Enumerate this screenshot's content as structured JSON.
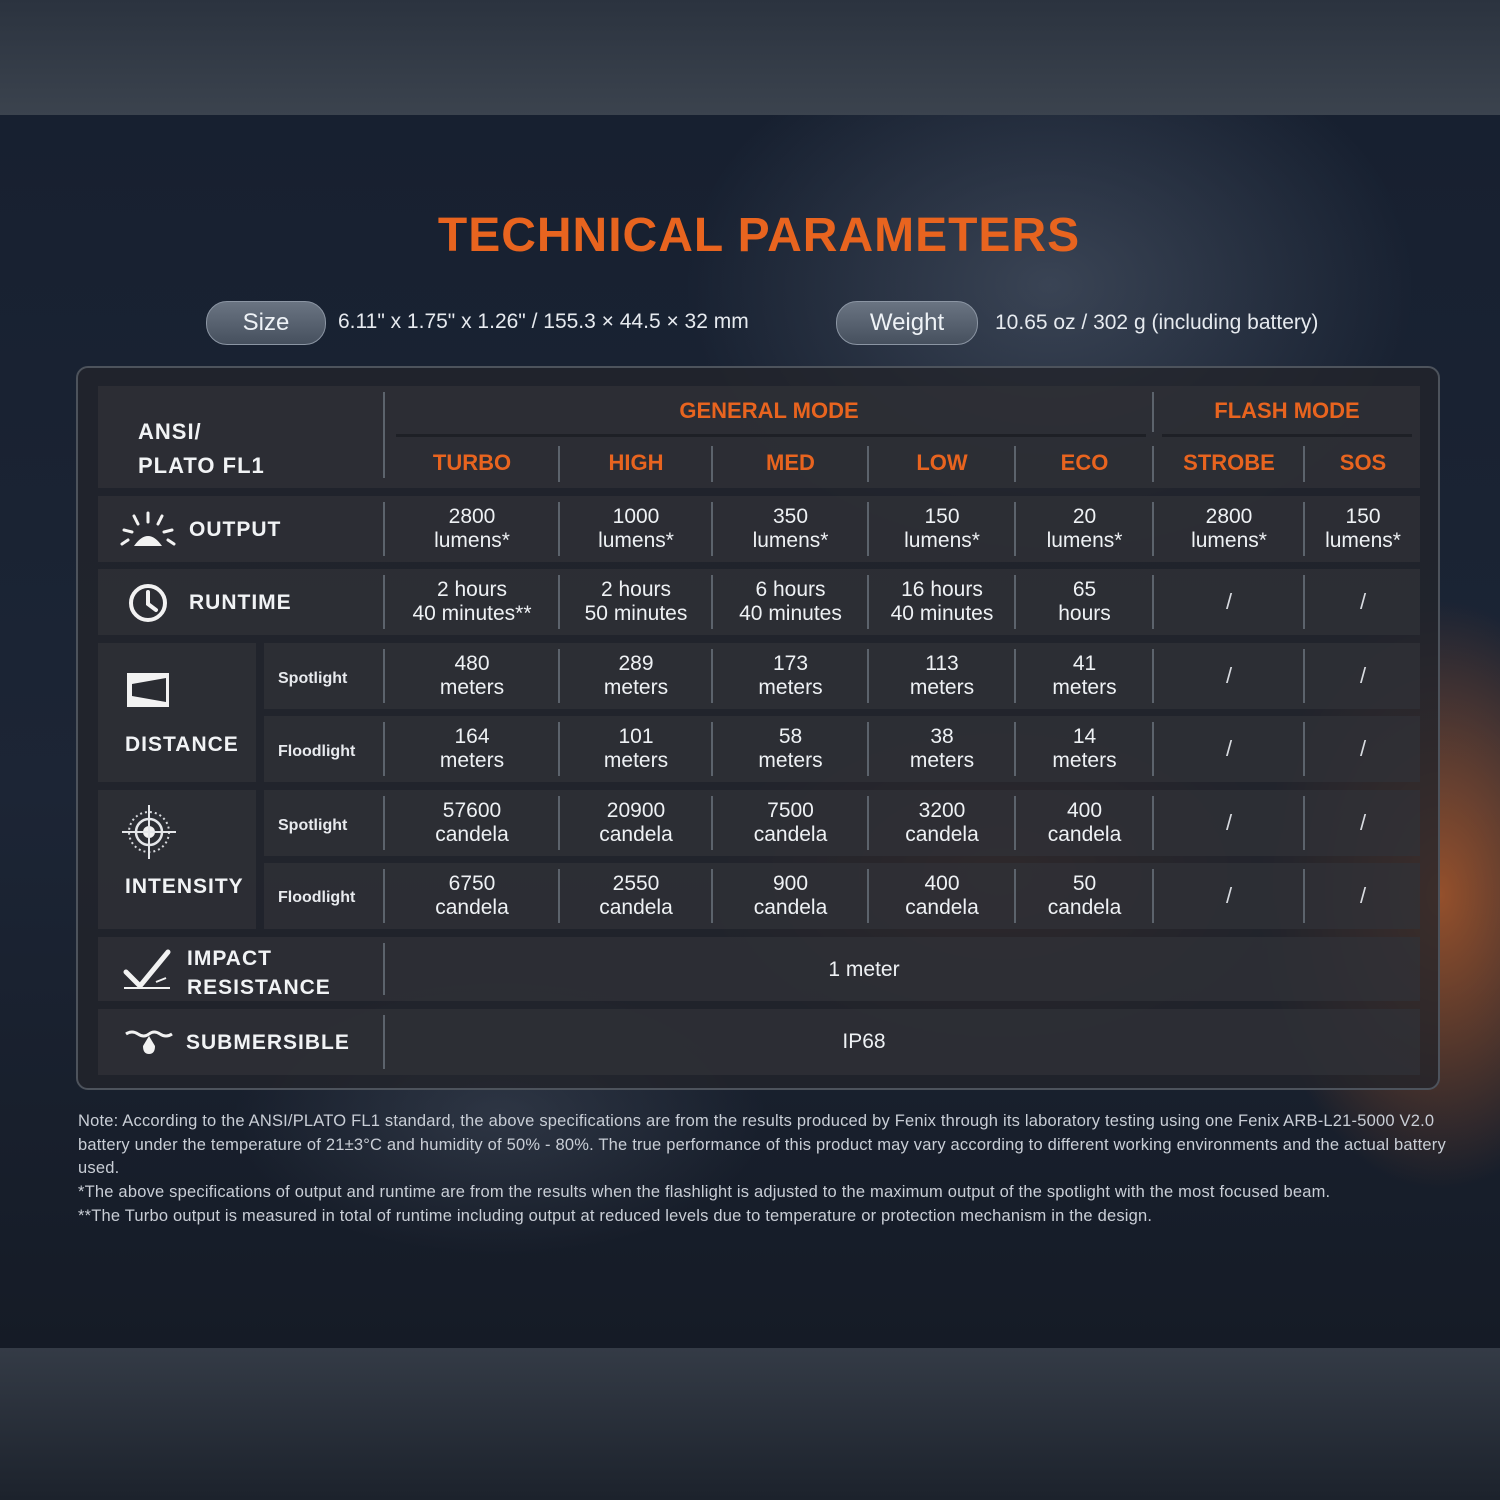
{
  "title": "TECHNICAL PARAMETERS",
  "specs": {
    "size_label": "Size",
    "size_value": "6.11\" x 1.75\" x 1.26\" / 155.3 × 44.5 × 32 mm",
    "weight_label": "Weight",
    "weight_value": "10.65 oz / 302 g (including battery)"
  },
  "table": {
    "corner_line1": "ANSI/",
    "corner_line2": "PLATO FL1",
    "group_general": "GENERAL MODE",
    "group_flash": "FLASH MODE",
    "modes": [
      "TURBO",
      "HIGH",
      "MED",
      "LOW",
      "ECO",
      "STROBE",
      "SOS"
    ],
    "rows": {
      "output": {
        "label": "OUTPUT",
        "icon": "light-burst-icon",
        "values": [
          [
            "2800",
            "lumens*"
          ],
          [
            "1000",
            "lumens*"
          ],
          [
            "350",
            "lumens*"
          ],
          [
            "150",
            "lumens*"
          ],
          [
            "20",
            "lumens*"
          ],
          [
            "2800",
            "lumens*"
          ],
          [
            "150",
            "lumens*"
          ]
        ]
      },
      "runtime": {
        "label": "RUNTIME",
        "icon": "clock-icon",
        "values": [
          [
            "2 hours",
            "40 minutes**"
          ],
          [
            "2 hours",
            "50 minutes"
          ],
          [
            "6 hours",
            "40 minutes"
          ],
          [
            "16 hours",
            "40 minutes"
          ],
          [
            "65",
            "hours"
          ],
          [
            "/"
          ],
          [
            "/"
          ]
        ]
      },
      "distance": {
        "label": "DISTANCE",
        "icon": "beam-distance-icon",
        "spotlight_label": "Spotlight",
        "floodlight_label": "Floodlight",
        "spotlight": [
          [
            "480",
            "meters"
          ],
          [
            "289",
            "meters"
          ],
          [
            "173",
            "meters"
          ],
          [
            "113",
            "meters"
          ],
          [
            "41",
            "meters"
          ],
          [
            "/"
          ],
          [
            "/"
          ]
        ],
        "floodlight": [
          [
            "164",
            "meters"
          ],
          [
            "101",
            "meters"
          ],
          [
            "58",
            "meters"
          ],
          [
            "38",
            "meters"
          ],
          [
            "14",
            "meters"
          ],
          [
            "/"
          ],
          [
            "/"
          ]
        ]
      },
      "intensity": {
        "label": "INTENSITY",
        "icon": "target-icon",
        "spotlight_label": "Spotlight",
        "floodlight_label": "Floodlight",
        "spotlight": [
          [
            "57600",
            "candela"
          ],
          [
            "20900",
            "candela"
          ],
          [
            "7500",
            "candela"
          ],
          [
            "3200",
            "candela"
          ],
          [
            "400",
            "candela"
          ],
          [
            "/"
          ],
          [
            "/"
          ]
        ],
        "floodlight": [
          [
            "6750",
            "candela"
          ],
          [
            "2550",
            "candela"
          ],
          [
            "900",
            "candela"
          ],
          [
            "400",
            "candela"
          ],
          [
            "50",
            "candela"
          ],
          [
            "/"
          ],
          [
            "/"
          ]
        ]
      },
      "impact": {
        "label_line1": "IMPACT",
        "label_line2": "RESISTANCE",
        "icon": "impact-check-icon",
        "value": "1 meter"
      },
      "submersible": {
        "label": "SUBMERSIBLE",
        "icon": "water-drop-icon",
        "value": "IP68"
      }
    }
  },
  "notes": [
    "Note:  According to the ANSI/PLATO FL1 standard, the above specifications are from the results produced by Fenix through its laboratory testing using one Fenix ARB-L21-5000 V2.0 battery under the temperature of 21±3°C and humidity of 50% - 80%. The true performance of this product may vary according to different working environments and the actual battery used.",
    "*The above specifications of output and runtime are from the results when the flashlight is adjusted to the maximum output of the spotlight with the most focused beam.",
    "**The Turbo output is measured in total of runtime including output at reduced levels due to temperature or protection mechanism in the design."
  ],
  "colors": {
    "accent": "#e8641f",
    "background": "#161d2a",
    "table_cell": "#303238"
  }
}
